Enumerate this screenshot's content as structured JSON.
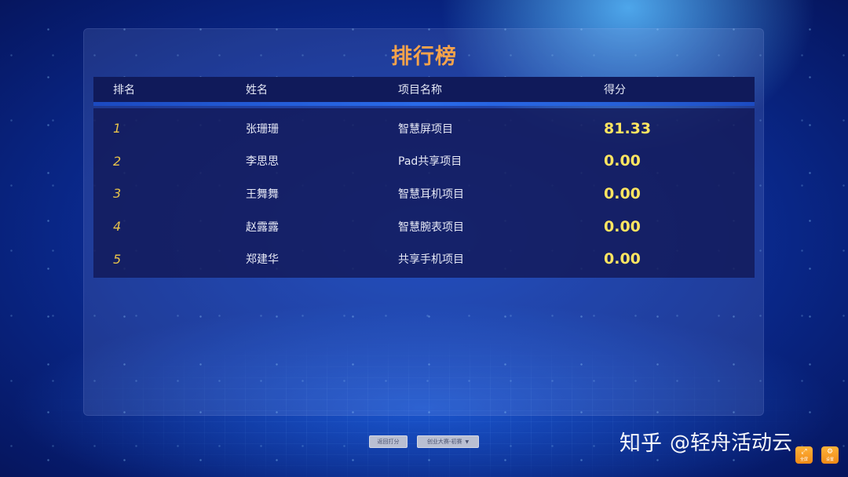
{
  "page": {
    "title": "排行榜"
  },
  "table": {
    "headers": [
      "排名",
      "姓名",
      "项目名称",
      "得分"
    ],
    "rows": [
      {
        "rank": "1",
        "name": "张珊珊",
        "project": "智慧屏项目",
        "score": "81.33"
      },
      {
        "rank": "2",
        "name": "李思思",
        "project": "Pad共享项目",
        "score": "0.00"
      },
      {
        "rank": "3",
        "name": "王舞舞",
        "project": "智慧耳机项目",
        "score": "0.00"
      },
      {
        "rank": "4",
        "name": "赵露露",
        "project": "智慧腕表项目",
        "score": "0.00"
      },
      {
        "rank": "5",
        "name": "郑建华",
        "project": "共享手机项目",
        "score": "0.00"
      }
    ]
  },
  "footer": {
    "back_label": "返回打分",
    "round_label": "创业大赛-初赛",
    "round_icon": "chevron-down-icon"
  },
  "watermark": {
    "site": "知乎",
    "handle": "@轻舟活动云"
  },
  "corner": {
    "fullscreen_label": "全屏",
    "fullscreen_icon": "expand-icon",
    "settings_label": "设置",
    "settings_icon": "gear-icon"
  },
  "colors": {
    "title": "#f6a34b",
    "rank": "#e8c34a",
    "score": "#ffe561",
    "background": "#0a2a8f",
    "corner_button": "#f5a02a"
  }
}
